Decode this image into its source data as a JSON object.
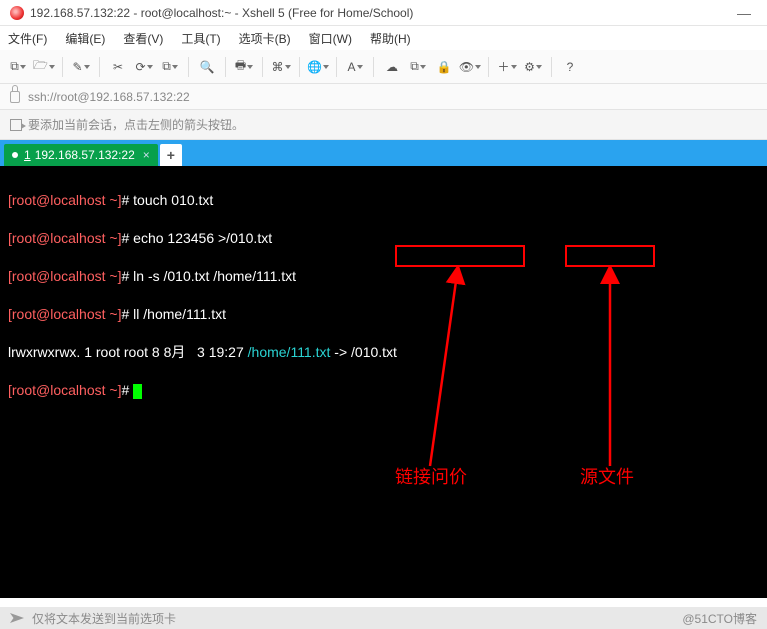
{
  "window": {
    "title": "192.168.57.132:22 - root@localhost:~ - Xshell 5 (Free for Home/School)",
    "minimize": "—"
  },
  "menu": {
    "file": "文件(F)",
    "edit": "编辑(E)",
    "view": "查看(V)",
    "tools": "工具(T)",
    "tabs": "选项卡(B)",
    "window": "窗口(W)",
    "help": "帮助(H)"
  },
  "toolbar_icons": {
    "newtab": "⧉",
    "open": "🗁",
    "brush": "✎",
    "scissors": "✂",
    "reload": "⟳",
    "props": "⧉",
    "search": "🔍",
    "print": "🖶",
    "code": "⌘",
    "globe": "🌐",
    "font": "A",
    "cloud": "☁",
    "two": "⧉",
    "lock": "🔒",
    "eye": "👁",
    "plus": "＋",
    "gear": "⚙",
    "help": "?"
  },
  "address": {
    "url": "ssh://root@192.168.57.132:22"
  },
  "tip": {
    "text": "要添加当前会话，点击左侧的箭头按钮。"
  },
  "tab": {
    "num": "1",
    "label": "192.168.57.132:22",
    "close": "×",
    "add": "+"
  },
  "term": {
    "prompt_open": "[",
    "prompt_close": "]",
    "user": "root",
    "at": "@",
    "host": "localhost",
    "path": " ~",
    "hash": "#",
    "l1": "touch 010.txt",
    "l2": "echo 123456 >/010.txt",
    "l3": "ln -s /010.txt /home/111.txt",
    "l4": "ll /home/111.txt",
    "ls_perm": "lrwxrwxrwx. 1 root root 8 8月   3 19:27 ",
    "ls_link": "/home/111.txt",
    "ls_arrow": " -> ",
    "ls_target": "/010.txt"
  },
  "annotations": {
    "linkfile": "链接问价",
    "srcfile": "源文件"
  },
  "footer": {
    "hint": "仅将文本发送到当前选项卡",
    "watermark": "@51CTO博客"
  }
}
